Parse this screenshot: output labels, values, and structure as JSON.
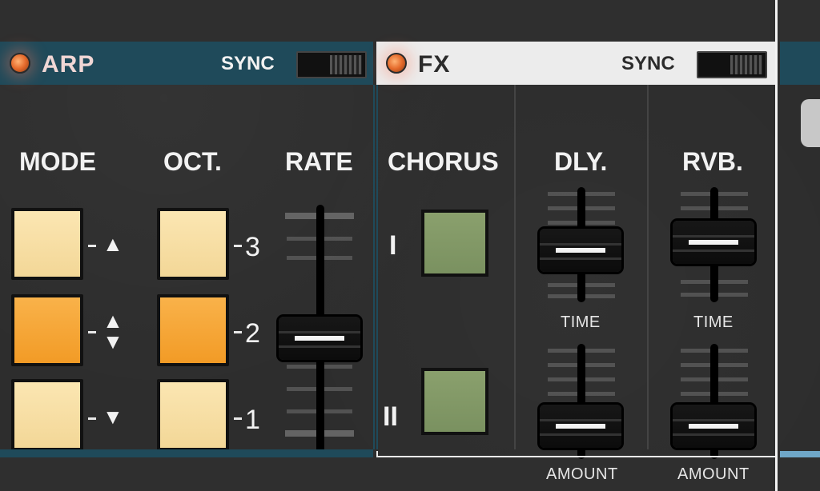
{
  "arp": {
    "title": "ARP",
    "sync_label": "SYNC",
    "labels": {
      "mode": "MODE",
      "oct": "OCT.",
      "rate": "RATE"
    },
    "mode_arrows": {
      "up": "▲",
      "updown": "▲▼",
      "down": "▼"
    },
    "oct_numbers": {
      "top": "3",
      "mid": "2",
      "bottom": "1"
    },
    "rate_level": 0.55
  },
  "fx": {
    "title": "FX",
    "sync_label": "SYNC",
    "labels": {
      "chorus": "CHORUS",
      "dly": "DLY.",
      "rvb": "RVB."
    },
    "chorus_rows": {
      "one": "I",
      "two": "II"
    },
    "sublabels": {
      "time": "TIME",
      "amount": "AMOUNT"
    },
    "dly_time_level": 0.45,
    "dly_amount_level": 0.15,
    "rvb_time_level": 0.55,
    "rvb_amount_level": 0.15
  },
  "colors": {
    "arp_header": "#1f4a5a",
    "fx_header": "#ececec",
    "cream_button": "#f7e0a6",
    "orange_button": "#f4a12d",
    "chorus_button": "#819a66"
  }
}
